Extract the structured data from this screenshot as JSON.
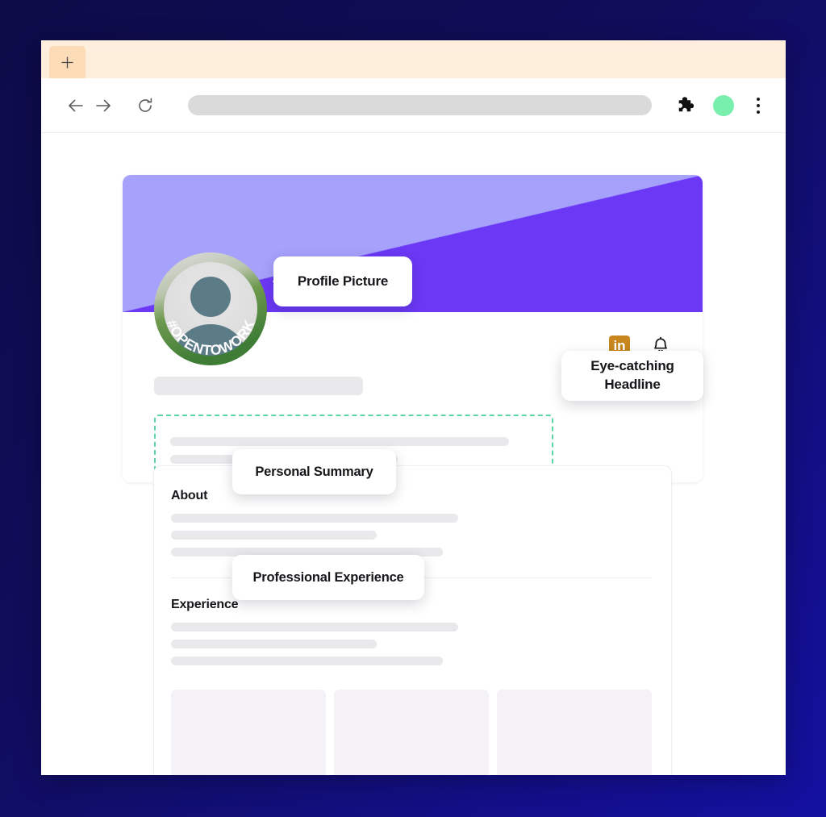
{
  "browser": {
    "tab_bar": {
      "new_tab_label": "+"
    },
    "toolbar": {
      "back_label": "Back",
      "forward_label": "Forward",
      "reload_label": "Reload",
      "address_value": "",
      "address_placeholder": "",
      "extensions_label": "Extensions",
      "profile_label": "Profile",
      "menu_label": "More"
    }
  },
  "page": {
    "profile": {
      "avatar": {
        "open_to_work_text": "#OPENTOWORK",
        "alt": "Profile photo placeholder"
      },
      "actions": {
        "linkedin_label": "in",
        "notifications_label": "Notifications"
      }
    },
    "sections": [
      {
        "title": "About"
      },
      {
        "title": "Experience"
      }
    ],
    "tiles": [
      "",
      "",
      ""
    ]
  },
  "annotations": {
    "profile_picture": "Profile Picture",
    "headline_line1": "Eye-catching",
    "headline_line2": "Headline",
    "personal_summary": "Personal Summary",
    "professional_experience": "Professional Experience"
  },
  "colors": {
    "page_background": "#0d0b47",
    "banner_light": "#a6a1fb",
    "banner_dark": "#6b38f5",
    "tab_strip": "#fdeedd",
    "highlight_dashed": "#5bd6a0",
    "linkedin": "#c8871e",
    "profile_dot": "#79efad",
    "skeleton": "#e9e9ec",
    "tile": "#f4f2f6"
  }
}
